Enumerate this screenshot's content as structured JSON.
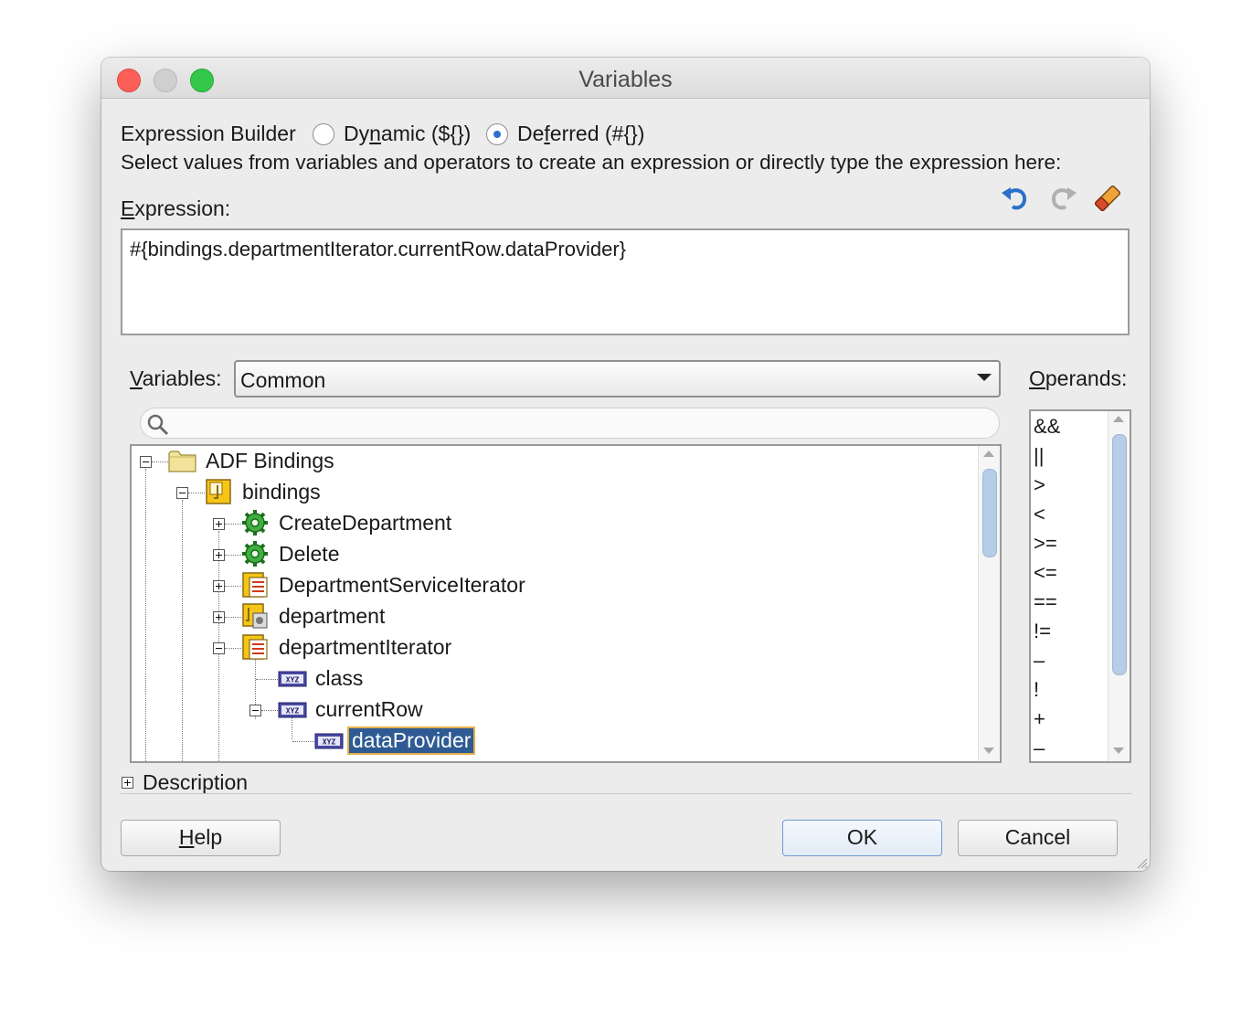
{
  "window": {
    "title": "Variables"
  },
  "builder": {
    "label": "Expression Builder",
    "options": [
      {
        "label_pre": "Dy",
        "label_u": "n",
        "label_post": "amic (${})",
        "checked": false
      },
      {
        "label_pre": "De",
        "label_u": "f",
        "label_post": "erred (#{})",
        "checked": true
      }
    ],
    "instructions": "Select values from variables and operators to create an expression or directly type the expression here:"
  },
  "expression": {
    "label_u": "E",
    "label_rest": "xpression:",
    "value": "#{bindings.departmentIterator.currentRow.dataProvider}",
    "tools": [
      "undo-icon",
      "redo-icon",
      "eraser-icon"
    ]
  },
  "variables": {
    "label_u": "V",
    "label_rest": "ariables:",
    "selected": "Common",
    "search_placeholder": ""
  },
  "tree": {
    "nodes": [
      {
        "label": "ADF Bindings",
        "icon": "folder-icon",
        "expanded": true,
        "level": 0
      },
      {
        "label": "bindings",
        "icon": "bindings-icon",
        "expanded": true,
        "level": 1
      },
      {
        "label": "CreateDepartment",
        "icon": "gear-icon",
        "expanded": false,
        "level": 2
      },
      {
        "label": "Delete",
        "icon": "gear-icon",
        "expanded": false,
        "level": 2
      },
      {
        "label": "DepartmentServiceIterator",
        "icon": "iterator-icon",
        "expanded": false,
        "level": 2
      },
      {
        "label": "department",
        "icon": "attribute-binding-icon",
        "expanded": false,
        "level": 2
      },
      {
        "label": "departmentIterator",
        "icon": "iterator-icon",
        "expanded": true,
        "level": 2
      },
      {
        "label": "class",
        "icon": "property-icon",
        "level": 3
      },
      {
        "label": "currentRow",
        "icon": "property-icon",
        "expanded": true,
        "level": 3
      },
      {
        "label": "dataProvider",
        "icon": "property-icon",
        "level": 4,
        "selected": true
      }
    ]
  },
  "operands": {
    "label_u": "O",
    "label_rest": "perands:",
    "items": [
      "&&",
      "||",
      ">",
      "<",
      ">=",
      "<=",
      "==",
      "!=",
      "–",
      "!",
      "+",
      "–"
    ]
  },
  "description": {
    "label": "Description"
  },
  "buttons": {
    "help_u": "H",
    "help_rest": "elp",
    "ok": "OK",
    "cancel": "Cancel"
  },
  "colors": {
    "selection": "#2e5b93",
    "radio_checked": "#2f6fd0",
    "close": "#fc5f57",
    "maximize": "#34c84a"
  }
}
